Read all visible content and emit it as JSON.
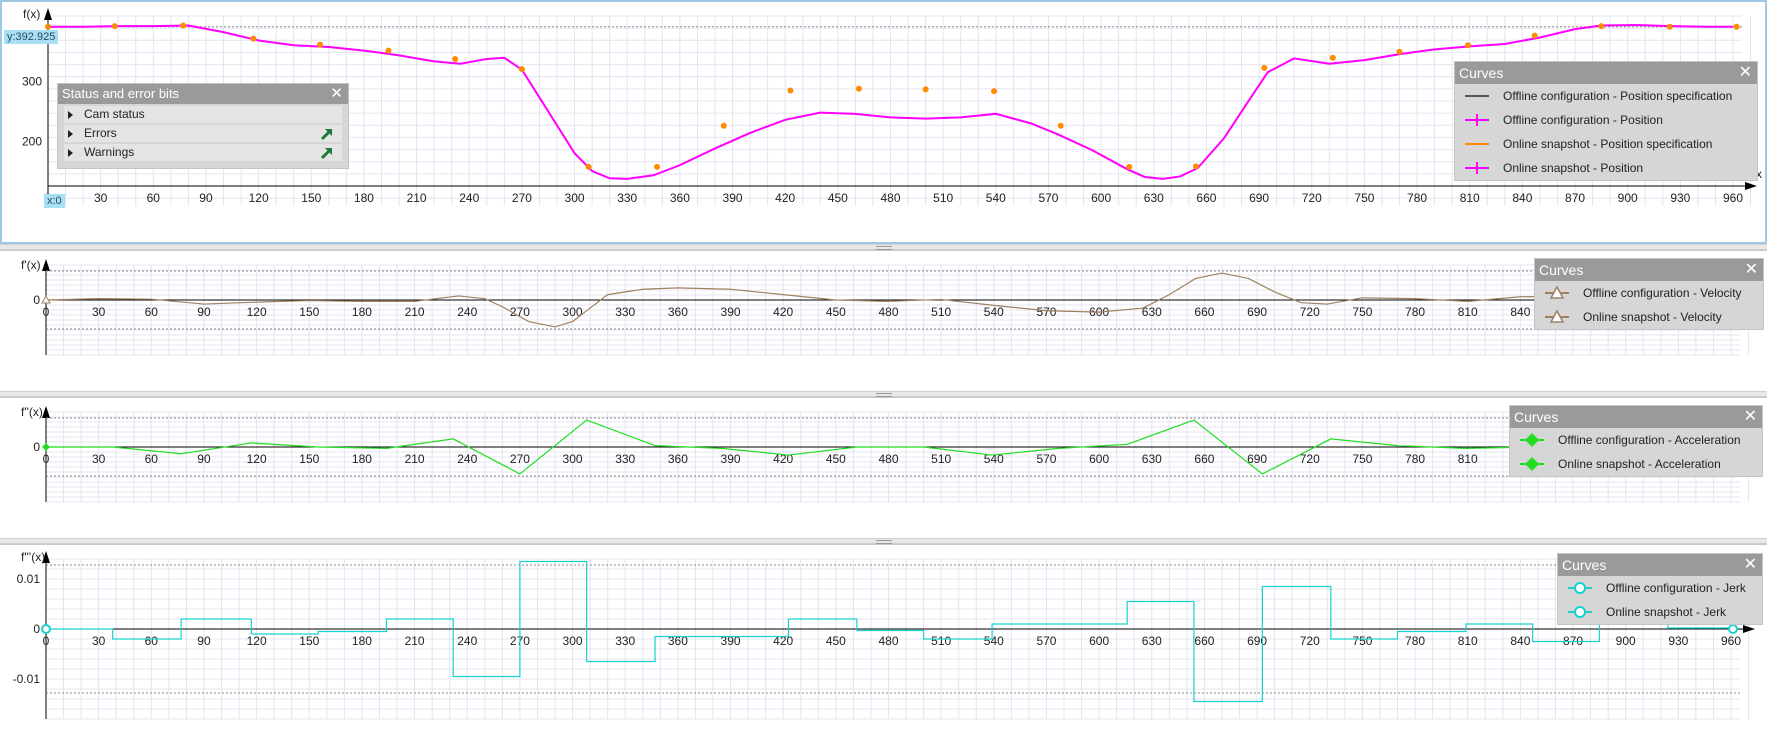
{
  "colors": {
    "grid": "#e4e4f2",
    "axis": "#000000",
    "position": "#ff00ff",
    "position_markers": "#ff8c00",
    "position_spec": "#555555",
    "online_spec": "#ff8c00",
    "velocity": "#a08060",
    "acceleration": "#22dd22",
    "jerk": "#19d0d0",
    "readout_bg": "#a9dff5",
    "legend_head": "#9a9a9a",
    "legend_bg": "#d6d6d6",
    "status_icon": "#1b7a3a"
  },
  "x_axis": {
    "label": "x",
    "ticks": [
      0,
      30,
      60,
      90,
      120,
      150,
      180,
      210,
      240,
      270,
      300,
      330,
      360,
      390,
      420,
      450,
      480,
      510,
      540,
      570,
      600,
      630,
      660,
      690,
      720,
      750,
      780,
      810,
      840,
      870,
      900,
      930,
      960
    ]
  },
  "readouts": {
    "y": "y:392.925",
    "x": "x:0"
  },
  "status": {
    "title": "Status and error bits",
    "rows": [
      {
        "label": "Cam status",
        "has_link": false
      },
      {
        "label": "Errors",
        "has_link": true
      },
      {
        "label": "Warnings",
        "has_link": true
      }
    ]
  },
  "legends": [
    {
      "title": "Curves",
      "close": "✕",
      "items": [
        {
          "label": "Offline configuration - Position specification",
          "marker": "line",
          "color": "#555555"
        },
        {
          "label": "Offline configuration - Position",
          "marker": "plus",
          "color": "#ff00ff"
        },
        {
          "label": "Online snapshot - Position specification",
          "marker": "line",
          "color": "#ff8c00"
        },
        {
          "label": "Online snapshot - Position",
          "marker": "plus",
          "color": "#ff00ff"
        }
      ]
    },
    {
      "title": "Curves",
      "close": "✕",
      "items": [
        {
          "label": "Offline configuration - Velocity",
          "marker": "triangle",
          "color": "#a08060"
        },
        {
          "label": "Online snapshot - Velocity",
          "marker": "triangle",
          "color": "#a08060"
        }
      ]
    },
    {
      "title": "Curves",
      "close": "✕",
      "items": [
        {
          "label": "Offline configuration - Acceleration",
          "marker": "diamond",
          "color": "#22dd22"
        },
        {
          "label": "Online snapshot - Acceleration",
          "marker": "diamond",
          "color": "#22dd22"
        }
      ]
    },
    {
      "title": "Curves",
      "close": "✕",
      "items": [
        {
          "label": "Offline configuration - Jerk",
          "marker": "circle",
          "color": "#19d0d0"
        },
        {
          "label": "Online snapshot - Jerk",
          "marker": "circle",
          "color": "#19d0d0"
        }
      ]
    }
  ],
  "chart_data": [
    {
      "type": "line",
      "ylabel": "f(x)",
      "xlim": [
        0,
        960
      ],
      "ylim": [
        125,
        410
      ],
      "yticks": [
        200,
        300
      ],
      "series": [
        {
          "name": "Offline configuration - Position",
          "x": [
            0,
            20,
            40,
            60,
            80,
            100,
            120,
            140,
            160,
            180,
            200,
            220,
            235,
            250,
            260,
            270,
            285,
            300,
            310,
            320,
            330,
            345,
            360,
            380,
            400,
            420,
            440,
            460,
            480,
            500,
            520,
            540,
            560,
            575,
            595,
            615,
            625,
            635,
            645,
            655,
            670,
            685,
            695,
            710,
            730,
            750,
            770,
            790,
            810,
            830,
            850,
            870,
            885,
            905,
            925,
            945,
            960
          ],
          "y": [
            392,
            392,
            393,
            393,
            394,
            383,
            369,
            361,
            358,
            352,
            344,
            334,
            330,
            338,
            340,
            320,
            250,
            180,
            150,
            138,
            137,
            143,
            160,
            188,
            214,
            236,
            248,
            246,
            240,
            238,
            240,
            246,
            230,
            212,
            185,
            153,
            140,
            137,
            141,
            155,
            205,
            272,
            316,
            339,
            330,
            336,
            346,
            354,
            359,
            363,
            374,
            388,
            394,
            395,
            393,
            392,
            392
          ]
        },
        {
          "name": "Online snapshot - Position",
          "x": [
            0,
            38,
            77,
            117,
            155,
            194,
            232,
            270,
            308,
            347,
            385,
            423,
            462,
            500,
            539,
            577,
            616,
            654,
            693,
            732,
            770,
            809,
            847,
            885,
            924,
            962
          ],
          "y": [
            392,
            393,
            394,
            372,
            362,
            352,
            338,
            321,
            157,
            157,
            226,
            285,
            288,
            287,
            284,
            226,
            157,
            158,
            323,
            340,
            350,
            361,
            377,
            393,
            392,
            392
          ]
        }
      ]
    },
    {
      "type": "line",
      "ylabel": "f'(x)",
      "xlim": [
        0,
        960
      ],
      "ylim": [
        -1.3,
        1.3
      ],
      "yticks": [
        0
      ],
      "series": [
        {
          "name": "Offline configuration - Velocity",
          "x": [
            0,
            30,
            60,
            90,
            120,
            150,
            180,
            210,
            235,
            250,
            260,
            275,
            290,
            300,
            310,
            320,
            340,
            360,
            390,
            420,
            450,
            480,
            510,
            540,
            570,
            600,
            625,
            640,
            655,
            670,
            685,
            700,
            715,
            730,
            750,
            780,
            810,
            840,
            870,
            900,
            930,
            960
          ],
          "y": [
            0,
            0.05,
            0.03,
            -0.15,
            -0.08,
            -0.02,
            -0.05,
            -0.05,
            0.15,
            0.05,
            -0.25,
            -0.8,
            -1.0,
            -0.8,
            -0.3,
            0.2,
            0.4,
            0.45,
            0.4,
            0.2,
            0,
            -0.05,
            0.02,
            -0.2,
            -0.4,
            -0.45,
            -0.3,
            0.2,
            0.8,
            1.0,
            0.8,
            0.3,
            -0.1,
            -0.15,
            0.08,
            0.05,
            -0.05,
            0.12,
            0.15,
            0.05,
            0.05,
            0
          ]
        }
      ]
    },
    {
      "type": "line",
      "ylabel": "f''(x)",
      "xlim": [
        0,
        960
      ],
      "ylim": [
        -1.3,
        1.3
      ],
      "yticks": [
        0
      ],
      "series": [
        {
          "name": "Offline configuration - Acceleration",
          "x": [
            0,
            38,
            77,
            117,
            155,
            194,
            232,
            270,
            308,
            347,
            385,
            423,
            462,
            500,
            539,
            577,
            616,
            654,
            693,
            732,
            770,
            809,
            847,
            885,
            924,
            962
          ],
          "y": [
            0,
            0,
            -0.25,
            0.15,
            0,
            -0.05,
            0.3,
            -1.0,
            1.0,
            0.05,
            -0.05,
            -0.3,
            0,
            0,
            -0.3,
            -0.05,
            0.1,
            1.0,
            -1.0,
            0.3,
            0.05,
            -0.05,
            0,
            -0.05,
            0,
            0
          ]
        }
      ]
    },
    {
      "type": "line",
      "ylabel": "f'''(x)",
      "xlim": [
        0,
        960
      ],
      "ylim": [
        -0.014,
        0.014
      ],
      "yticks": [
        0.01,
        0,
        -0.01
      ],
      "ytick_labels": [
        "0.01",
        "0",
        "-0.01"
      ],
      "series": [
        {
          "name": "Offline configuration - Jerk",
          "step": true,
          "x": [
            0,
            38,
            77,
            117,
            155,
            194,
            232,
            270,
            308,
            347,
            385,
            423,
            462,
            500,
            539,
            577,
            616,
            654,
            693,
            732,
            770,
            809,
            847,
            885,
            924,
            962
          ],
          "y": [
            0,
            -0.002,
            0.002,
            -0.001,
            -0.0005,
            0.002,
            -0.0095,
            0.0135,
            -0.0065,
            -0.0015,
            -0.0015,
            0.002,
            -0.0003,
            -0.002,
            0.001,
            0.001,
            0.0055,
            -0.0145,
            0.0085,
            -0.002,
            -0.0005,
            0.001,
            -0.0025,
            0.0015,
            0.0002,
            0
          ]
        }
      ]
    }
  ]
}
